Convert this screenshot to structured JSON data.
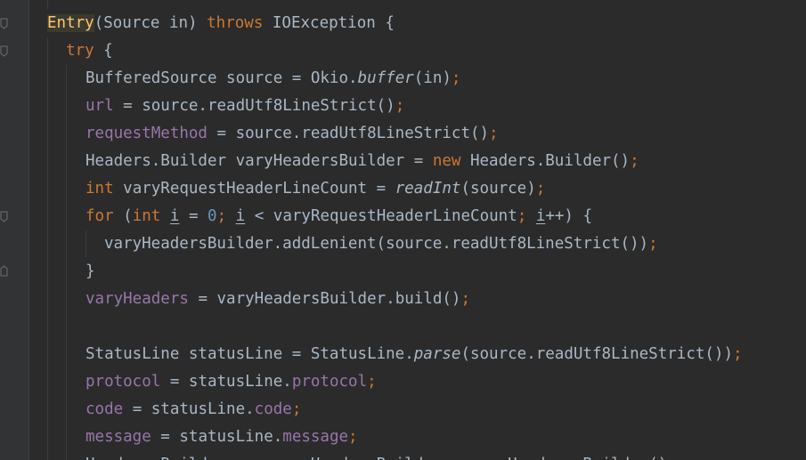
{
  "editor": {
    "theme_colors": {
      "background": "#2b2b2b",
      "keyword": "#cc7832",
      "method_decl": "#ffc66d",
      "field": "#9876aa",
      "number": "#6897bb",
      "text": "#a9b7c6"
    },
    "lines": [
      {
        "tokens": [
          {
            "text": "Entry",
            "cls": "tok-entry-bg"
          },
          {
            "text": "(Source in) ",
            "cls": ""
          },
          {
            "text": "throws ",
            "cls": "tok-kw"
          },
          {
            "text": "IOException {",
            "cls": ""
          }
        ]
      },
      {
        "tokens": [
          {
            "text": "try ",
            "cls": "tok-kw"
          },
          {
            "text": "{",
            "cls": ""
          }
        ]
      },
      {
        "tokens": [
          {
            "text": "BufferedSource source = Okio.",
            "cls": ""
          },
          {
            "text": "buffer",
            "cls": "tok-italic"
          },
          {
            "text": "(in)",
            "cls": ""
          },
          {
            "text": ";",
            "cls": "tok-semi"
          }
        ]
      },
      {
        "tokens": [
          {
            "text": "url",
            "cls": "tok-field"
          },
          {
            "text": " = source.readUtf8LineStrict()",
            "cls": ""
          },
          {
            "text": ";",
            "cls": "tok-semi"
          }
        ]
      },
      {
        "tokens": [
          {
            "text": "requestMethod",
            "cls": "tok-field"
          },
          {
            "text": " = source.readUtf8LineStrict()",
            "cls": ""
          },
          {
            "text": ";",
            "cls": "tok-semi"
          }
        ]
      },
      {
        "tokens": [
          {
            "text": "Headers.Builder varyHeadersBuilder = ",
            "cls": ""
          },
          {
            "text": "new ",
            "cls": "tok-kw"
          },
          {
            "text": "Headers.Builder()",
            "cls": ""
          },
          {
            "text": ";",
            "cls": "tok-semi"
          }
        ]
      },
      {
        "tokens": [
          {
            "text": "int ",
            "cls": "tok-kw"
          },
          {
            "text": "varyRequestHeaderLineCount = ",
            "cls": ""
          },
          {
            "text": "readInt",
            "cls": "tok-italic"
          },
          {
            "text": "(source)",
            "cls": ""
          },
          {
            "text": ";",
            "cls": "tok-semi"
          }
        ]
      },
      {
        "tokens": [
          {
            "text": "for ",
            "cls": "tok-kw"
          },
          {
            "text": "(",
            "cls": ""
          },
          {
            "text": "int ",
            "cls": "tok-kw"
          },
          {
            "text": "i",
            "cls": "tok-under"
          },
          {
            "text": " = ",
            "cls": ""
          },
          {
            "text": "0",
            "cls": "tok-num"
          },
          {
            "text": "; ",
            "cls": "tok-semi"
          },
          {
            "text": "i",
            "cls": "tok-under"
          },
          {
            "text": " < varyRequestHeaderLineCount",
            "cls": ""
          },
          {
            "text": "; ",
            "cls": "tok-semi"
          },
          {
            "text": "i",
            "cls": "tok-under"
          },
          {
            "text": "++) {",
            "cls": ""
          }
        ]
      },
      {
        "tokens": [
          {
            "text": "varyHeadersBuilder.addLenient(source.readUtf8LineStrict())",
            "cls": ""
          },
          {
            "text": ";",
            "cls": "tok-semi"
          }
        ]
      },
      {
        "tokens": [
          {
            "text": "}",
            "cls": ""
          }
        ]
      },
      {
        "tokens": [
          {
            "text": "varyHeaders",
            "cls": "tok-field"
          },
          {
            "text": " = varyHeadersBuilder.build()",
            "cls": ""
          },
          {
            "text": ";",
            "cls": "tok-semi"
          }
        ]
      },
      {
        "tokens": []
      },
      {
        "tokens": [
          {
            "text": "StatusLine statusLine = StatusLine.",
            "cls": ""
          },
          {
            "text": "parse",
            "cls": "tok-italic"
          },
          {
            "text": "(source.readUtf8LineStrict())",
            "cls": ""
          },
          {
            "text": ";",
            "cls": "tok-semi"
          }
        ]
      },
      {
        "tokens": [
          {
            "text": "protocol",
            "cls": "tok-field"
          },
          {
            "text": " = statusLine.",
            "cls": ""
          },
          {
            "text": "protocol",
            "cls": "tok-field"
          },
          {
            "text": ";",
            "cls": "tok-semi"
          }
        ]
      },
      {
        "tokens": [
          {
            "text": "code",
            "cls": "tok-field"
          },
          {
            "text": " = statusLine.",
            "cls": ""
          },
          {
            "text": "code",
            "cls": "tok-field"
          },
          {
            "text": ";",
            "cls": "tok-semi"
          }
        ]
      },
      {
        "tokens": [
          {
            "text": "message",
            "cls": "tok-field"
          },
          {
            "text": " = statusLine.",
            "cls": ""
          },
          {
            "text": "message",
            "cls": "tok-field"
          },
          {
            "text": ";",
            "cls": "tok-semi"
          }
        ]
      },
      {
        "tokens": [
          {
            "text": "Headers.Builder responseHeadersBuilder = ",
            "cls": ""
          },
          {
            "text": "new ",
            "cls": "tok-kw"
          },
          {
            "text": "Headers.Builder()",
            "cls": ""
          },
          {
            "text": ";",
            "cls": "tok-semi"
          }
        ]
      }
    ]
  }
}
